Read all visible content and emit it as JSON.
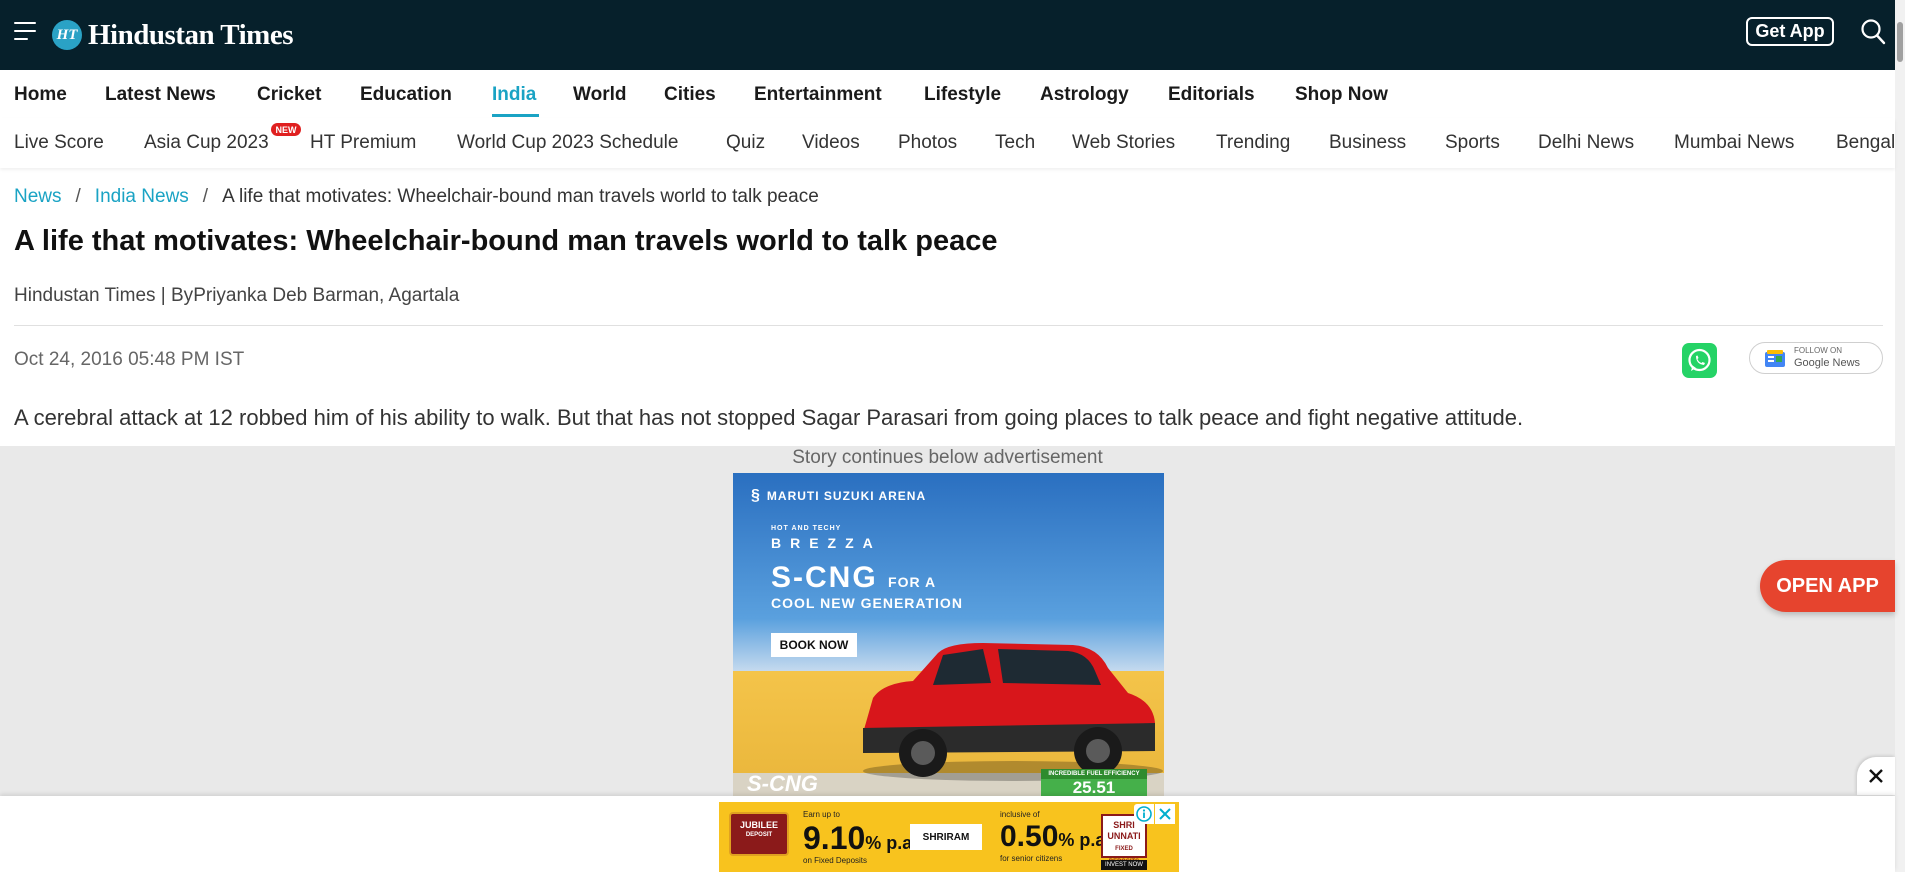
{
  "header": {
    "logo_badge": "HT",
    "logo_text": "Hindustan Times",
    "get_app_label": "Get App",
    "icons": {
      "menu": "hamburger-menu-icon",
      "search": "search-icon"
    }
  },
  "nav_primary": {
    "items": [
      "Home",
      "Latest News",
      "Cricket",
      "Education",
      "India",
      "World",
      "Cities",
      "Entertainment",
      "Lifestyle",
      "Astrology",
      "Editorials",
      "Shop Now"
    ],
    "active": "India"
  },
  "nav_secondary": {
    "items": [
      "Live Score",
      "Asia Cup 2023",
      "HT Premium",
      "World Cup 2023 Schedule",
      "Quiz",
      "Videos",
      "Photos",
      "Tech",
      "Web Stories",
      "Trending",
      "Business",
      "Sports",
      "Delhi News",
      "Mumbai News",
      "Bengal"
    ],
    "new_badge": "NEW"
  },
  "breadcrumb": {
    "items": [
      "News",
      "India News",
      "A life that motivates: Wheelchair-bound man travels world to talk peace"
    ],
    "separator": "/"
  },
  "article": {
    "headline": "A life that motivates: Wheelchair-bound man travels world to talk peace",
    "byline_source": "Hindustan Times | By",
    "byline_author": "Priyanka Deb Barman, Agartala",
    "date": "Oct 24, 2016 05:48 PM IST",
    "summary": "A cerebral attack at 12 robbed him of his ability to walk. But that has not stopped Sagar Parasari from going places to talk peace and fight negative attitude."
  },
  "share": {
    "whatsapp_icon": "whatsapp-icon",
    "google_news_follow": "FOLLOW ON",
    "google_news_label": "Google News"
  },
  "ad": {
    "caption": "Story continues below advertisement",
    "brand": "MARUTI SUZUKI ARENA",
    "tagline": "HOT AND TECHY",
    "model": "BREZZA",
    "headline": "S-CNG",
    "headline_small": "FOR A",
    "subheadline": "COOL NEW GENERATION",
    "cta": "BOOK NOW",
    "badge": "S-CNG",
    "efficiency_label": "INCREDIBLE FUEL EFFICIENCY",
    "efficiency_value": "25.51"
  },
  "open_app_label": "OPEN APP",
  "sticky_banner": {
    "jubilee": "JUBILEE",
    "jubilee_sub": "DEPOSIT",
    "earn_label": "Earn up to",
    "rate1": "9.10",
    "rate_suffix": "% p.a.",
    "fd_label": "on Fixed Deposits",
    "lender": "SHRIRAM",
    "inclusive_label": "inclusive of",
    "rate2": "0.50",
    "senior_label": "for senior citizens",
    "product": "SHRI UNNATI",
    "product_sub": "FIXED DEPOSITS",
    "invest_label": "INVEST NOW",
    "icons": {
      "info": "ad-info-icon",
      "close": "ad-close-icon"
    }
  },
  "colors": {
    "header_bg": "#06202b",
    "accent": "#1aa3c4",
    "open_app_bg": "#e6442e",
    "whatsapp": "#25d366"
  }
}
